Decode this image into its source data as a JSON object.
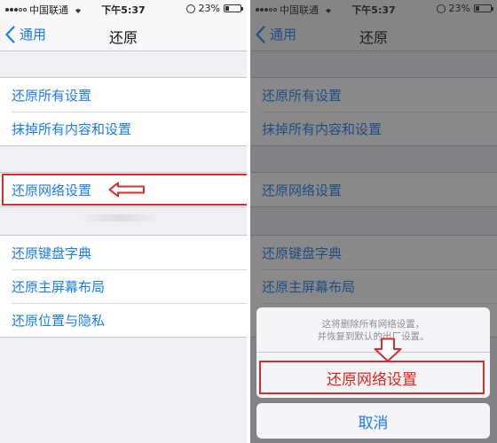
{
  "status_bar": {
    "carrier": "中国联通",
    "time": "下午5:37",
    "battery": "23%",
    "battery_level": 0.23
  },
  "nav": {
    "back_label": "通用",
    "title": "还原"
  },
  "groups": {
    "g1": [
      "还原所有设置",
      "抹掉所有内容和设置"
    ],
    "g2": [
      "还原网络设置"
    ],
    "g3": [
      "还原键盘字典",
      "还原主屏幕布局",
      "还原位置与隐私"
    ]
  },
  "action_sheet": {
    "message_line1": "这将删除所有网络设置，",
    "message_line2": "并恢复到默认的出厂设置。",
    "confirm_label": "还原网络设置",
    "cancel_label": "取消"
  },
  "colors": {
    "accent": "#1a7cf5",
    "highlight": "#d92c2c",
    "destructive": "#e5241b"
  },
  "icons": {
    "back": "chevron-left-icon",
    "wifi": "wifi-icon",
    "rotation_lock": "rotation-lock-icon",
    "battery": "battery-icon",
    "annotation_left": "arrow-left-icon",
    "annotation_down": "arrow-down-icon"
  }
}
